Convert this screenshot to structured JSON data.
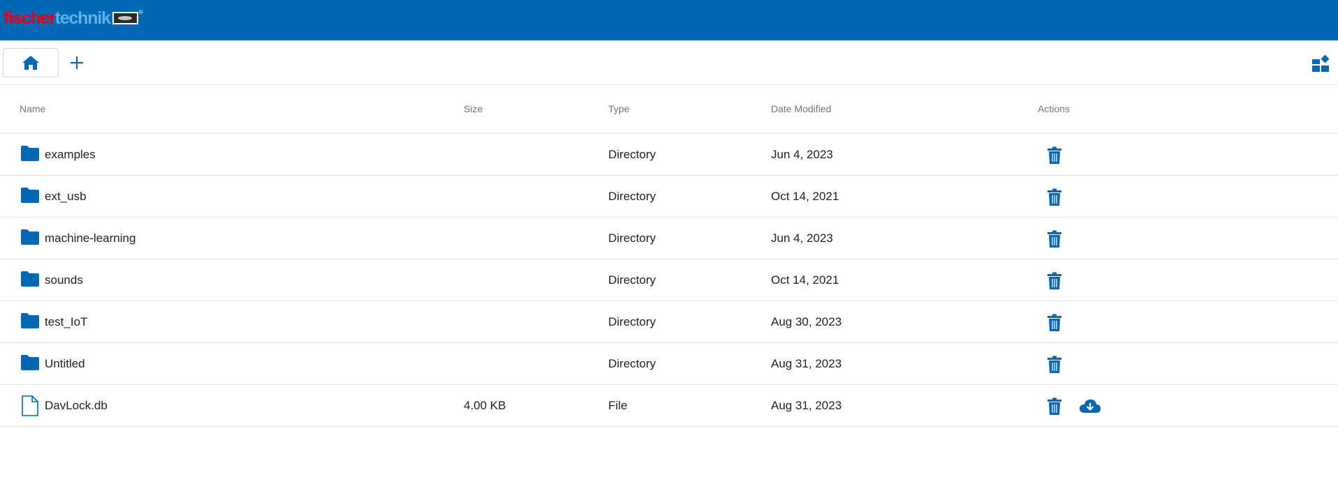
{
  "app": {
    "logo_part1": "fischer",
    "logo_part2": "technik",
    "logo_reg": "®",
    "accent_color": "#0068b4",
    "icon_color": "#0068b4"
  },
  "toolbar": {
    "home_icon": "home-icon",
    "add_icon": "plus-icon",
    "view_icon": "view-toggle-icon"
  },
  "table": {
    "headers": {
      "name": "Name",
      "size": "Size",
      "type": "Type",
      "date": "Date Modified",
      "actions": "Actions"
    },
    "rows": [
      {
        "icon": "folder-icon",
        "name": "examples",
        "size": "",
        "type": "Directory",
        "date": "Jun 4, 2023",
        "actions": [
          "trash-icon"
        ]
      },
      {
        "icon": "folder-icon",
        "name": "ext_usb",
        "size": "",
        "type": "Directory",
        "date": "Oct 14, 2021",
        "actions": [
          "trash-icon"
        ]
      },
      {
        "icon": "folder-icon",
        "name": "machine-learning",
        "size": "",
        "type": "Directory",
        "date": "Jun 4, 2023",
        "actions": [
          "trash-icon"
        ]
      },
      {
        "icon": "folder-icon",
        "name": "sounds",
        "size": "",
        "type": "Directory",
        "date": "Oct 14, 2021",
        "actions": [
          "trash-icon"
        ]
      },
      {
        "icon": "folder-icon",
        "name": "test_IoT",
        "size": "",
        "type": "Directory",
        "date": "Aug 30, 2023",
        "actions": [
          "trash-icon"
        ]
      },
      {
        "icon": "folder-icon",
        "name": "Untitled",
        "size": "",
        "type": "Directory",
        "date": "Aug 31, 2023",
        "actions": [
          "trash-icon"
        ]
      },
      {
        "icon": "file-icon",
        "name": "DavLock.db",
        "size": "4.00 KB",
        "type": "File",
        "date": "Aug 31, 2023",
        "actions": [
          "trash-icon",
          "cloud-download-icon"
        ]
      }
    ]
  }
}
